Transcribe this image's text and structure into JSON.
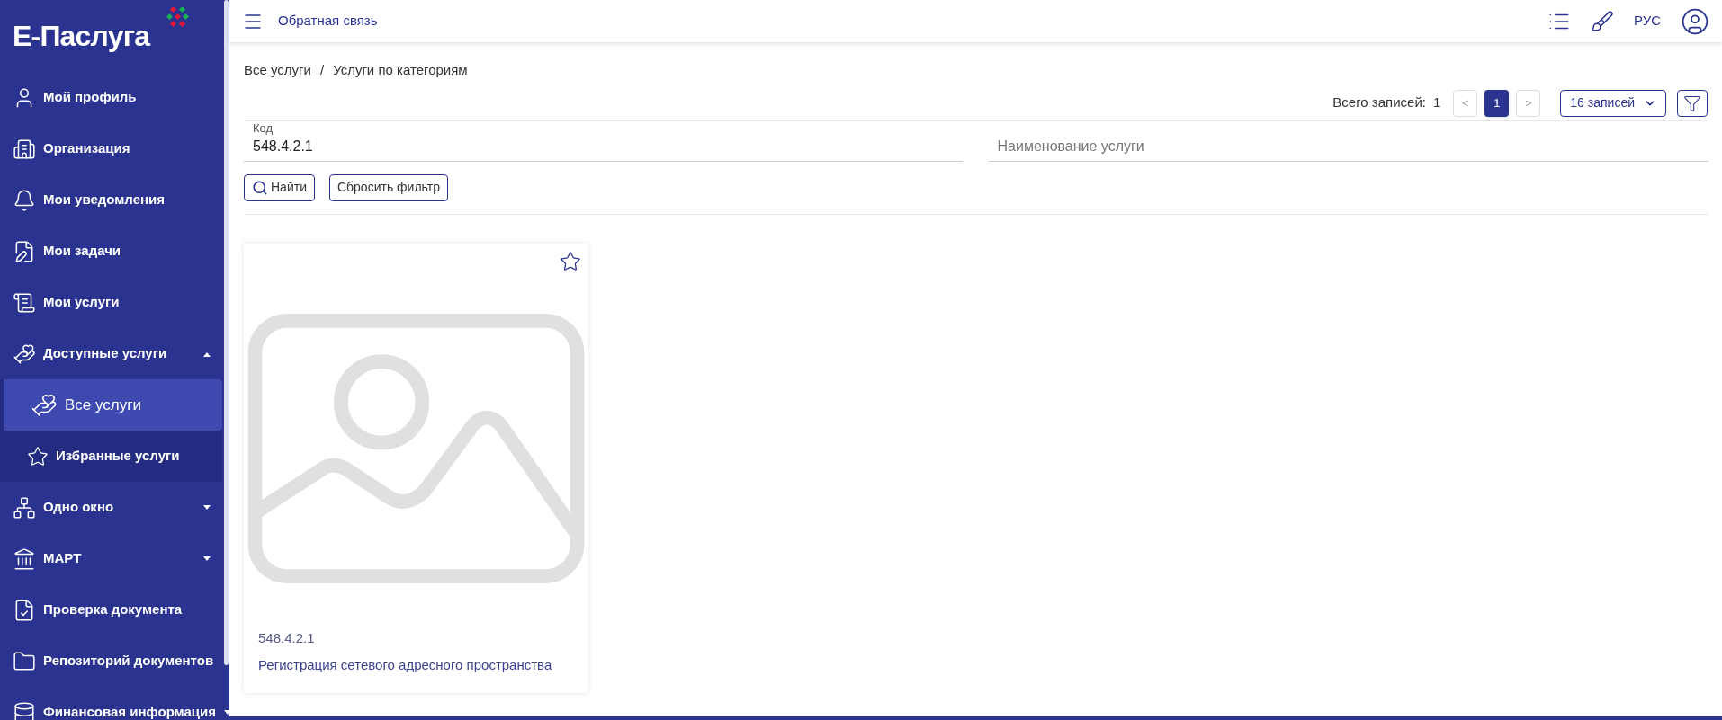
{
  "logo": {
    "text": "Е-Паслуга"
  },
  "sidebar": {
    "items": [
      {
        "kind": "link",
        "label": "Мой профиль",
        "selected": false
      },
      {
        "kind": "link",
        "label": "Организация",
        "selected": false
      },
      {
        "kind": "link",
        "label": "Мои уведомления",
        "selected": false
      },
      {
        "kind": "link",
        "label": "Мои задачи",
        "selected": false
      },
      {
        "kind": "link",
        "label": "Мои услуги",
        "selected": false
      },
      {
        "kind": "group",
        "label": "Доступные услуги",
        "selected": false,
        "expanded": true,
        "children": [
          {
            "label": "Все услуги",
            "selected": true
          },
          {
            "label": "Избранные услуги",
            "selected": false
          }
        ]
      },
      {
        "kind": "group",
        "label": "Одно окно",
        "selected": false,
        "expanded": false
      },
      {
        "kind": "group",
        "label": "МАРТ",
        "selected": false,
        "expanded": false
      },
      {
        "kind": "link",
        "label": "Проверка документа",
        "selected": false
      },
      {
        "kind": "link",
        "label": "Репозиторий документов",
        "selected": false
      },
      {
        "kind": "group",
        "label": "Финансовая информация",
        "selected": false,
        "expanded": false
      }
    ]
  },
  "topbar": {
    "title": "Обратная связь",
    "language": "РУС"
  },
  "breadcrumb": [
    "Все услуги",
    "Услуги по категориям"
  ],
  "breadcrumb_separator": "/",
  "pagination": {
    "total_label": "Всего записей:",
    "total": "1",
    "prev": "<",
    "next": ">",
    "pages": [
      {
        "label": "1",
        "selected": true
      }
    ],
    "page_size": "16 записей"
  },
  "filters": {
    "code": {
      "label": "Код",
      "value": "548.4.2.1"
    },
    "name": {
      "placeholder": "Наименование услуги"
    },
    "find_button": "Найти",
    "reset_button": "Сбросить фильтр"
  },
  "cards": [
    {
      "code": "548.4.2.1",
      "title": "Регистрация сетевого адресного пространства",
      "favorite": false
    }
  ]
}
